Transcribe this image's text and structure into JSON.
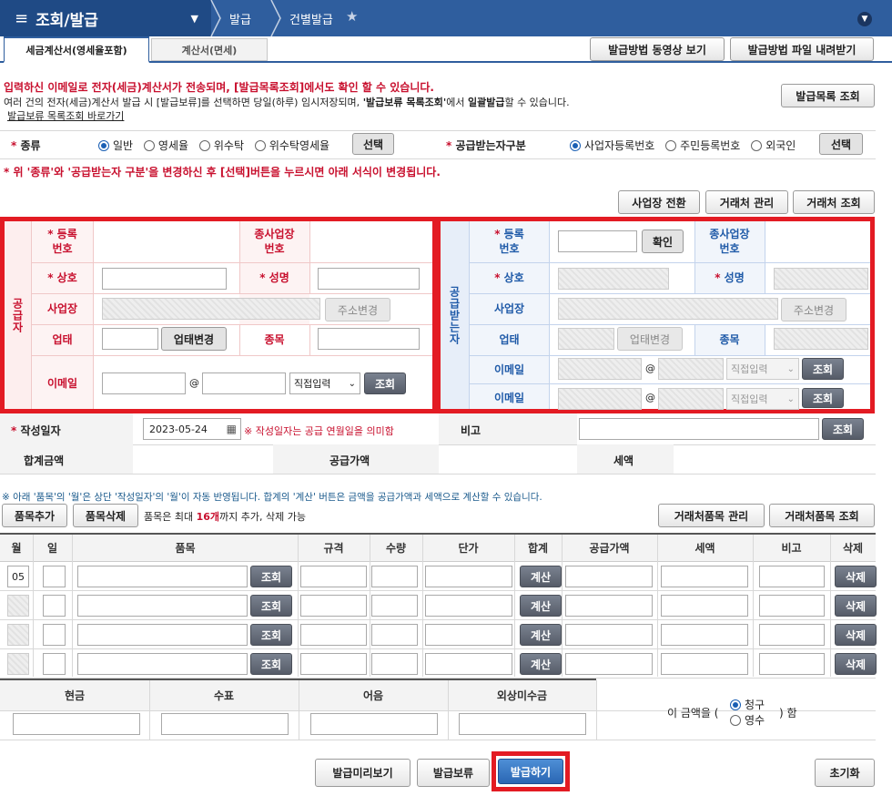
{
  "nav": {
    "menu_title": "조회/발급",
    "crumb1": "발급",
    "crumb2": "건별발급"
  },
  "tabs": {
    "tab1": "세금계산서(영세율포함)",
    "tab2": "계산서(면세)"
  },
  "help": {
    "video": "발급방법 동영상 보기",
    "file": "발급방법 파일 내려받기",
    "list_lookup": "발급목록 조회"
  },
  "notices": {
    "line1": "입력하신 이메일로 전자(세금)계산서가 전송되며, [발급목록조회]에서도 확인 할 수 있습니다.",
    "line2a": "여러 건의 전자(세금)계산서 발급 시 [발급보류]를 선택하면 당일(하루) 임시저장되며, ",
    "line2b": "'발급보류 목록조회'",
    "line2c": "에서 ",
    "line2d": "일괄발급",
    "line2e": "할 수 있습니다.",
    "hold_link": "발급보류 목록조회 바로가기",
    "change_note": "* 위 '종류'와 '공급받는자 구분'을 변경하신 후 [선택]버튼을 누르시면 아래 서식이 변경됩니다."
  },
  "type_row": {
    "label": "종류",
    "opt1": "일반",
    "opt2": "영세율",
    "opt3": "위수탁",
    "opt4": "위수탁영세율",
    "select": "선택",
    "recv_label": "공급받는자구분",
    "ropt1": "사업자등록번호",
    "ropt2": "주민등록번호",
    "ropt3": "외국인",
    "rselect": "선택"
  },
  "biz_buttons": {
    "switch": "사업장 전환",
    "manage": "거래처 관리",
    "lookup": "거래처 조회"
  },
  "supplier": {
    "title": "공급자",
    "reg_no": "등록\n번호",
    "sub_no": "종사업장\n번호",
    "name": "상호",
    "ceo": "성명",
    "addr": "사업장",
    "addr_change": "주소변경",
    "biz_type": "업태",
    "biz_type_change": "업태변경",
    "item": "종목",
    "email": "이메일",
    "at": "@",
    "direct": "직접입력",
    "email_lookup": "조회"
  },
  "receiver": {
    "title": "공급받는자",
    "reg_no": "등록\n번호",
    "confirm": "확인",
    "sub_no": "종사업장\n번호",
    "name": "상호",
    "ceo": "성명",
    "addr": "사업장",
    "addr_change": "주소변경",
    "biz_type": "업태",
    "biz_type_change": "업태변경",
    "item": "종목",
    "email1": "이메일",
    "email2": "이메일",
    "at": "@",
    "direct": "직접입력",
    "lookup": "조회"
  },
  "date_row": {
    "label": "작성일자",
    "date": "2023-05-24",
    "note": "※ 작성일자는 공급 연월일을 의미함",
    "remark": "비고",
    "remark_lookup": "조회"
  },
  "sum_row": {
    "total": "합계금액",
    "supply": "공급가액",
    "tax": "세액"
  },
  "items": {
    "note": "※ 아래 '품목'의 '월'은 상단 '작성일자'의 '월'이 자동 반영됩니다. 합계의 '계산' 버튼은 금액을 공급가액과 세액으로 계산할 수 있습니다.",
    "add": "품목추가",
    "del": "품목삭제",
    "max_a": "품목은 최대 ",
    "max_b": "16개",
    "max_c": "까지 추가, 삭제 가능",
    "manage": "거래처품목 관리",
    "lookup": "거래처품목 조회",
    "headers": [
      "월",
      "일",
      "품목",
      "규격",
      "수량",
      "단가",
      "합계",
      "공급가액",
      "세액",
      "비고",
      "삭제"
    ],
    "month": "05",
    "lookup_btn": "조회",
    "calc_btn": "계산",
    "del_btn": "삭제"
  },
  "payment": {
    "cash": "현금",
    "check": "수표",
    "bill": "어음",
    "credit": "외상미수금",
    "amount_pre": "이 금액을 (",
    "claim": "청구",
    "receipt": "영수",
    "amount_post": ") 함"
  },
  "actions": {
    "preview": "발급미리보기",
    "hold": "발급보류",
    "issue": "발급하기",
    "reset": "초기화"
  }
}
